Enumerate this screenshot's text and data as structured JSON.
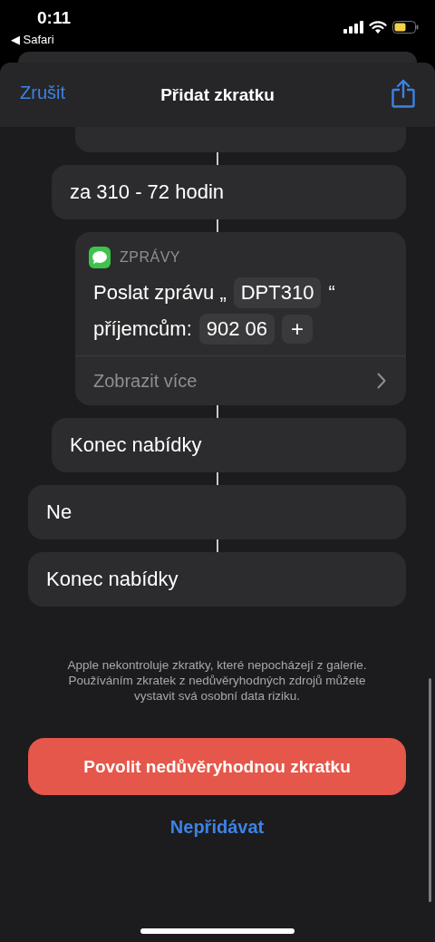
{
  "status_bar": {
    "time": "0:11",
    "back": "◀ Safari"
  },
  "header": {
    "cancel": "Zrušit",
    "title": "Přidat zkratku"
  },
  "actions": [
    {
      "kind": "nested",
      "children": [
        {
          "kind": "nested",
          "children": [
            {
              "kind": "stub"
            }
          ]
        },
        {
          "kind": "text",
          "label": "za 310 - 72 hodin"
        },
        {
          "kind": "nested",
          "children": [
            {
              "kind": "message",
              "app": "ZPRÁVY",
              "lines": [
                [
                  {
                    "kind": "text",
                    "text": "Poslat zprávu „"
                  },
                  {
                    "kind": "token",
                    "text": "DPT310"
                  },
                  {
                    "kind": "text",
                    "text": "“"
                  }
                ],
                [
                  {
                    "kind": "text",
                    "text": "příjemcům:"
                  },
                  {
                    "kind": "token",
                    "text": "902 06"
                  },
                  {
                    "kind": "add",
                    "text": "+"
                  }
                ]
              ],
              "more": "Zobrazit více"
            }
          ]
        },
        {
          "kind": "text",
          "label": "Konec nabídky"
        }
      ]
    },
    {
      "kind": "text",
      "label": "Ne"
    },
    {
      "kind": "text",
      "label": "Konec nabídky"
    }
  ],
  "notice": "Apple nekontroluje zkratky, které nepocházejí z galerie. Používáním zkratek z nedůvěryhodných zdrojů můžete vystavit svá osobní data riziku.",
  "primary_button": "Povolit nedůvěryhodnou zkratku",
  "secondary_button": "Nepřidávat"
}
